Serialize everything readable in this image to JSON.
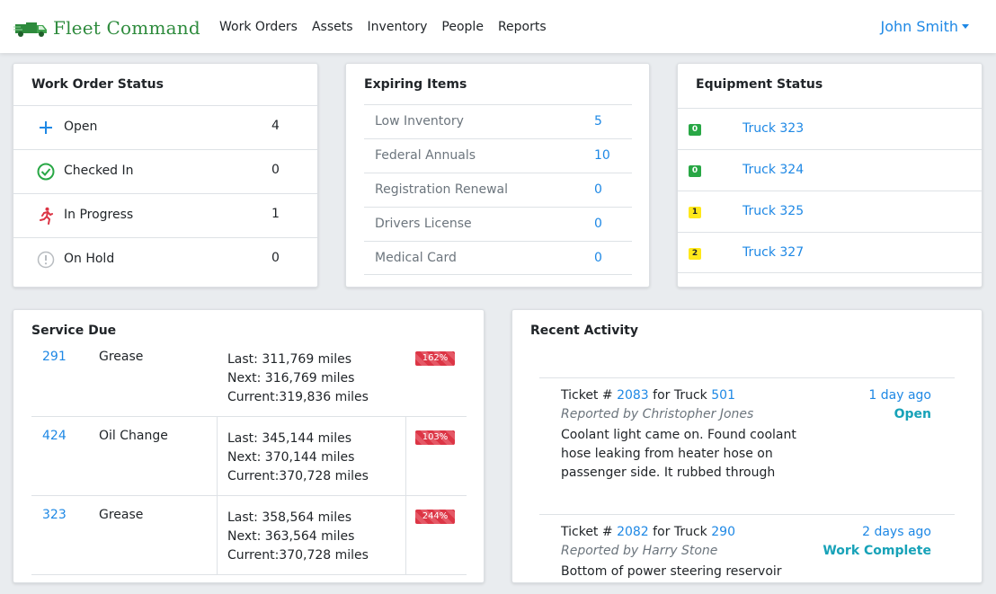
{
  "navbar": {
    "brand": "Fleet Command",
    "links": [
      "Work Orders",
      "Assets",
      "Inventory",
      "People",
      "Reports"
    ],
    "user": "John Smith"
  },
  "work_order_status": {
    "title": "Work Order Status",
    "rows": [
      {
        "label": "Open",
        "count": "4",
        "icon": "plus-icon"
      },
      {
        "label": "Checked In",
        "count": "0",
        "icon": "check-circle-icon"
      },
      {
        "label": "In Progress",
        "count": "1",
        "icon": "running-person-icon"
      },
      {
        "label": "On Hold",
        "count": "0",
        "icon": "exclamation-circle-icon"
      }
    ]
  },
  "expiring_items": {
    "title": "Expiring Items",
    "rows": [
      {
        "label": "Low Inventory",
        "count": "5"
      },
      {
        "label": "Federal Annuals",
        "count": "10"
      },
      {
        "label": "Registration Renewal",
        "count": "0"
      },
      {
        "label": "Drivers License",
        "count": "0"
      },
      {
        "label": "Medical Card",
        "count": "0"
      }
    ]
  },
  "equipment_status": {
    "title": "Equipment Status",
    "rows": [
      {
        "badge": "0",
        "badge_color": "#28a745",
        "truck": "Truck 323"
      },
      {
        "badge": "0",
        "badge_color": "#28a745",
        "truck": "Truck 324"
      },
      {
        "badge": "1",
        "badge_color": "#ffe81a",
        "truck": "Truck 325"
      },
      {
        "badge": "2",
        "badge_color": "#ffe81a",
        "truck": "Truck 327"
      }
    ]
  },
  "service_due": {
    "title": "Service Due",
    "rows": [
      {
        "unit": "291",
        "service": "Grease",
        "last": "Last: 311,769 miles",
        "next": "Next: 316,769 miles",
        "current": "Current:319,836 miles",
        "percent": "162%"
      },
      {
        "unit": "424",
        "service": "Oil Change",
        "last": "Last: 345,144 miles",
        "next": "Next: 370,144 miles",
        "current": "Current:370,728 miles",
        "percent": "103%"
      },
      {
        "unit": "323",
        "service": "Grease",
        "last": "Last: 358,564 miles",
        "next": "Next: 363,564 miles",
        "current": "Current:370,728 miles",
        "percent": "244%"
      }
    ]
  },
  "recent_activity": {
    "title": "Recent Activity",
    "items": [
      {
        "ticket_prefix": "Ticket #",
        "ticket": "2083",
        "for_truck": "for Truck",
        "truck": "501",
        "reported": "Reported by Christopher Jones",
        "description": "Coolant light came on. Found coolant hose leaking from heater hose on passenger side. It rubbed through",
        "when": "1 day ago",
        "status": "Open"
      },
      {
        "ticket_prefix": "Ticket #",
        "ticket": "2082",
        "for_truck": "for Truck",
        "truck": "290",
        "reported": "Reported by Harry Stone",
        "description": "Bottom of power steering reservoir",
        "when": "2 days ago",
        "status": "Work Complete"
      }
    ]
  },
  "colors": {
    "accent": "#1e88e5",
    "brand_green": "#2e8b3d",
    "danger": "#dc3545",
    "info": "#17a2b8",
    "success": "#28a745",
    "warning": "#ffe81a"
  }
}
